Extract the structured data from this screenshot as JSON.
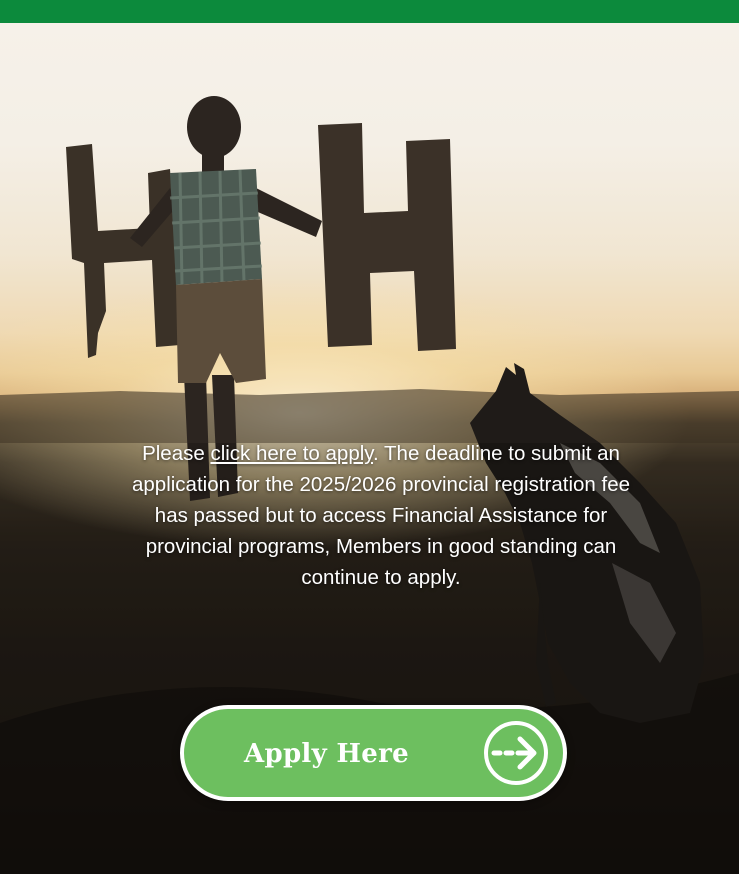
{
  "notice": {
    "prefix": "Please ",
    "link_text": "click here to apply",
    "suffix": ". The deadline to submit an application for the 2025/2026 provincial registration fee has passed but to access Financial Assistance for provincial programs, Members in good standing can continue to apply."
  },
  "apply_button": {
    "label": "Apply Here",
    "icon": "arrow-circle-right-icon"
  },
  "colors": {
    "top_bar": "#0c8a3c",
    "button_fill": "#6dbf5f",
    "button_border": "#ffffff",
    "text": "#ffffff"
  }
}
